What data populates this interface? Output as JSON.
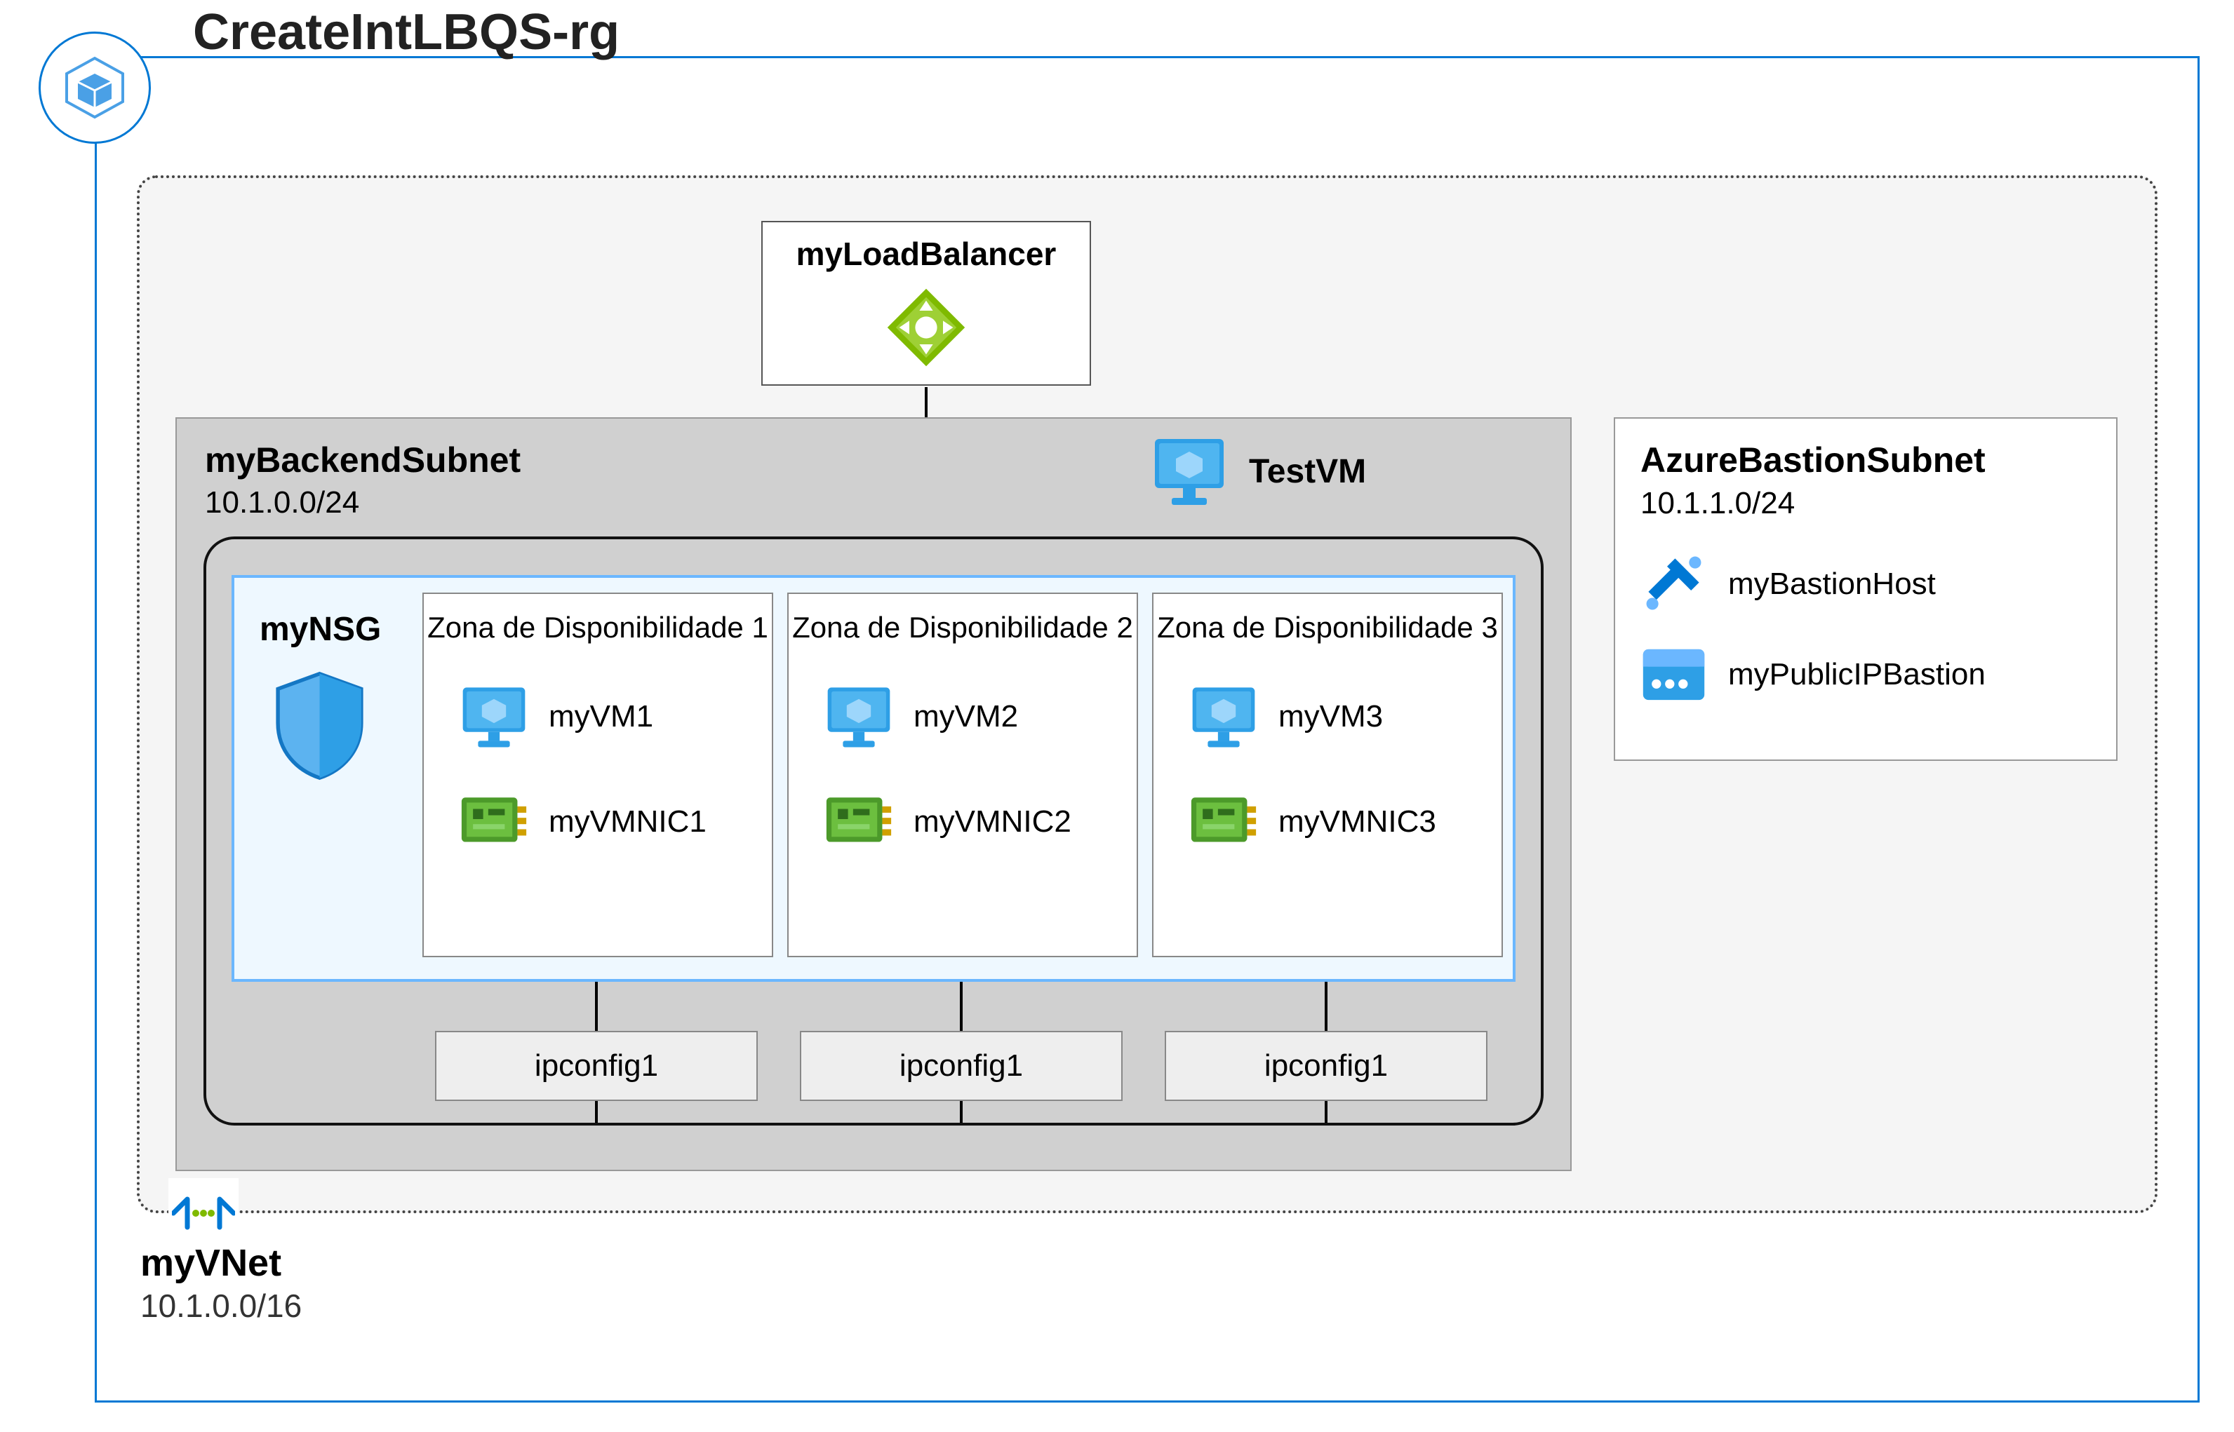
{
  "resource_group": {
    "title": "CreateIntLBQS-rg",
    "icon": "resource-group-icon"
  },
  "vnet": {
    "name": "myVNet",
    "cidr": "10.1.0.0/16",
    "icon": "vnet-icon"
  },
  "load_balancer": {
    "name": "myLoadBalancer",
    "icon": "load-balancer-icon"
  },
  "backend_subnet": {
    "name": "myBackendSubnet",
    "cidr": "10.1.0.0/24"
  },
  "test_vm": {
    "name": "TestVM",
    "icon": "vm-icon"
  },
  "nsg": {
    "name": "myNSG",
    "icon": "shield-icon"
  },
  "availability_zones": [
    {
      "title": "Zona de Disponibilidade 1",
      "vm": "myVM1",
      "nic": "myVMNIC1",
      "ipconfig": "ipconfig1"
    },
    {
      "title": "Zona de Disponibilidade 2",
      "vm": "myVM2",
      "nic": "myVMNIC2",
      "ipconfig": "ipconfig1"
    },
    {
      "title": "Zona de Disponibilidade 3",
      "vm": "myVM3",
      "nic": "myVMNIC3",
      "ipconfig": "ipconfig1"
    }
  ],
  "bastion_subnet": {
    "name": "AzureBastionSubnet",
    "cidr": "10.1.1.0/24",
    "host": "myBastionHost",
    "public_ip": "myPublicIPBastion"
  },
  "colors": {
    "azure_blue": "#0078d4",
    "light_blue": "#6bb7ff",
    "panel_bg": "#eef8ff",
    "subnet_bg": "#d0d0d0",
    "vnet_bg": "#f5f5f5"
  }
}
